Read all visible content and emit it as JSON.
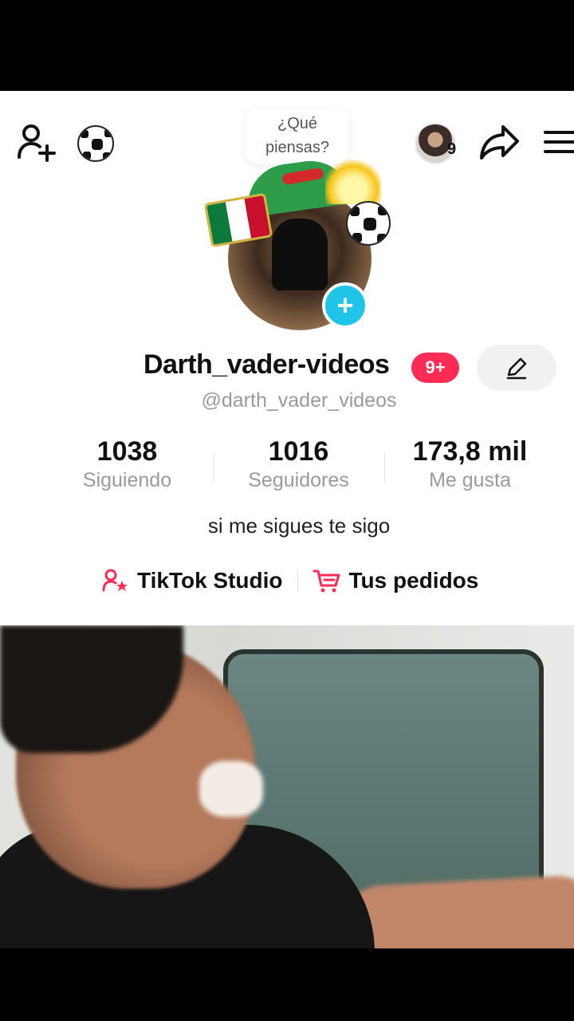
{
  "header": {
    "bubble_line1": "¿Qué",
    "bubble_line2": "piensas?",
    "friend_count": "9"
  },
  "profile": {
    "display_name": "Darth_vader-videos",
    "notif_badge": "9+",
    "handle": "@darth_vader_videos",
    "bio": "si me sigues te sigo"
  },
  "stats": [
    {
      "value": "1038",
      "label": "Siguiendo"
    },
    {
      "value": "1016",
      "label": "Seguidores"
    },
    {
      "value": "173,8 mil",
      "label": "Me gusta"
    }
  ],
  "links": {
    "studio": "TikTok Studio",
    "orders": "Tus pedidos"
  },
  "colors": {
    "accent": "#fe2c55",
    "add_badge": "#20c4e8"
  }
}
